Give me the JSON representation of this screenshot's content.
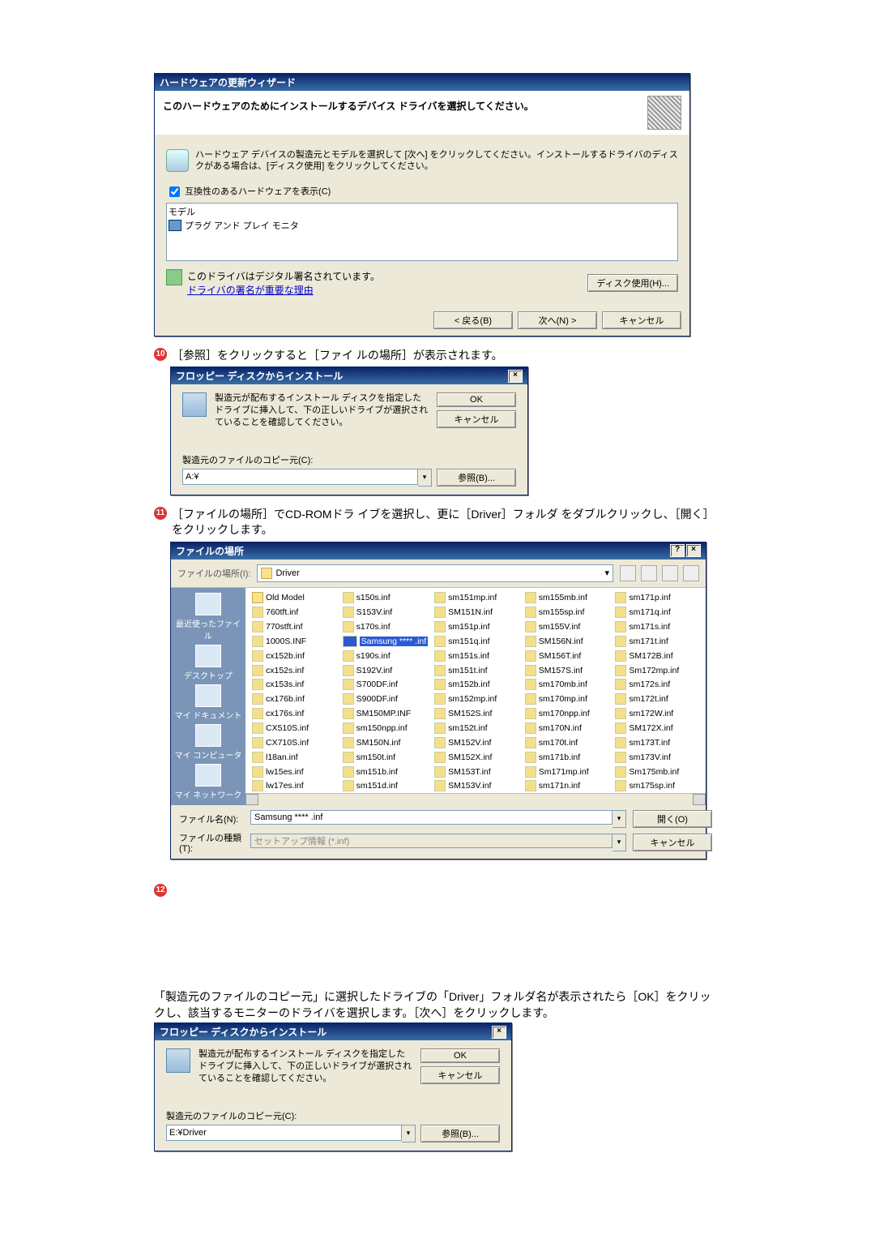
{
  "wizard1": {
    "title": "ハードウェアの更新ウィザード",
    "heading": "このハードウェアのためにインストールするデバイス ドライバを選択してください。",
    "info": "ハードウェア デバイスの製造元とモデルを選択して [次へ] をクリックしてください。インストールするドライバのディスクがある場合は、[ディスク使用] をクリックしてください。",
    "checkbox_label": "互換性のあるハードウェアを表示(C)",
    "model_header": "モデル",
    "model_item": "プラグ アンド プレイ モニタ",
    "signed_msg": "このドライバはデジタル署名されています。",
    "signed_link": "ドライバの署名が重要な理由",
    "disk_btn": "ディスク使用(H)...",
    "back_btn": "< 戻る(B)",
    "next_btn": "次へ(N) >",
    "cancel_btn": "キャンセル"
  },
  "step10": {
    "num": "10",
    "text": "［参照］をクリックすると［ファイ ルの場所］が表示されます。"
  },
  "floppy1": {
    "title": "フロッピー ディスクからインストール",
    "msg": "製造元が配布するインストール ディスクを指定したドライブに挿入して、下の正しいドライブが選択されていることを確認してください。",
    "ok": "OK",
    "cancel": "キャンセル",
    "copy_from_label": "製造元のファイルのコピー元(C):",
    "copy_from_value": "A:¥",
    "browse": "参照(B)..."
  },
  "step11": {
    "num": "11",
    "text": "［ファイルの場所］でCD-ROMドラ イブを選択し、更に［Driver］フォルダ をダブルクリックし、［開く］をクリックします。"
  },
  "filebrowser": {
    "title": "ファイルの場所",
    "path_label": "ファイルの場所(I):",
    "path_value": "Driver",
    "places": [
      "最近使ったファイル",
      "デスクトップ",
      "マイ ドキュメント",
      "マイ コンピュータ",
      "マイ ネットワーク"
    ],
    "columns": [
      [
        "Old Model",
        "760tft.inf",
        "770stft.inf",
        "1000S.INF",
        "cx152b.inf",
        "cx152s.inf",
        "cx153s.inf",
        "cx176b.inf",
        "cx176s.inf",
        "CX510S.inf",
        "CX710S.inf",
        "l18an.inf",
        "lw15es.inf",
        "lw17es.inf"
      ],
      [
        "s150s.inf",
        "S153V.inf",
        "s170s.inf",
        "Samsung **** .inf",
        "s190s.inf",
        "S192V.inf",
        "S700DF.inf",
        "S900DF.inf",
        "SM150MP.INF",
        "sm150npp.inf",
        "SM150N.inf",
        "sm150t.inf",
        "sm151b.inf",
        "sm151d.inf"
      ],
      [
        "sm151mp.inf",
        "SM151N.inf",
        "sm151p.inf",
        "sm151q.inf",
        "sm151s.inf",
        "sm151t.inf",
        "sm152b.inf",
        "sm152mp.inf",
        "SM152S.inf",
        "sm152t.inf",
        "SM152V.inf",
        "SM152X.inf",
        "SM153T.inf",
        "SM153V.inf"
      ],
      [
        "sm155mb.inf",
        "sm155sp.inf",
        "sm155V.inf",
        "SM156N.inf",
        "SM156T.inf",
        "SM157S.inf",
        "sm170mb.inf",
        "sm170mp.inf",
        "sm170npp.inf",
        "sm170N.inf",
        "sm170t.inf",
        "sm171b.inf",
        "Sm171mp.inf",
        "sm171n.inf"
      ],
      [
        "sm171p.inf",
        "sm171q.inf",
        "sm171s.inf",
        "sm171t.inf",
        "SM172B.inf",
        "Sm172mp.inf",
        "sm172s.inf",
        "sm172t.inf",
        "sm172W.inf",
        "SM172X.inf",
        "sm173T.inf",
        "sm173V.inf",
        "Sm175mb.inf",
        "sm175sp.inf"
      ]
    ],
    "selected": "Samsung **** .inf",
    "folder_item": "Old Model",
    "filename_label": "ファイル名(N):",
    "filename_value": "Samsung **** .inf",
    "filetype_label": "ファイルの種類(T):",
    "filetype_value": "セットアップ情報 (*.inf)",
    "open_btn": "開く(O)",
    "cancel_btn": "キャンセル"
  },
  "step12_num": "12",
  "step12_text": "「製造元のファイルのコピー元」に選択したドライブの「Driver」フォルダ名が表示されたら［OK］をクリックし、該当するモニターのドライバを選択します。［次へ］をクリックします。",
  "floppy2": {
    "title": "フロッピー ディスクからインストール",
    "msg": "製造元が配布するインストール ディスクを指定したドライブに挿入して、下の正しいドライブが選択されていることを確認してください。",
    "ok": "OK",
    "cancel": "キャンセル",
    "copy_from_label": "製造元のファイルのコピー元(C):",
    "copy_from_value": "E:¥Driver",
    "browse": "参照(B)..."
  }
}
